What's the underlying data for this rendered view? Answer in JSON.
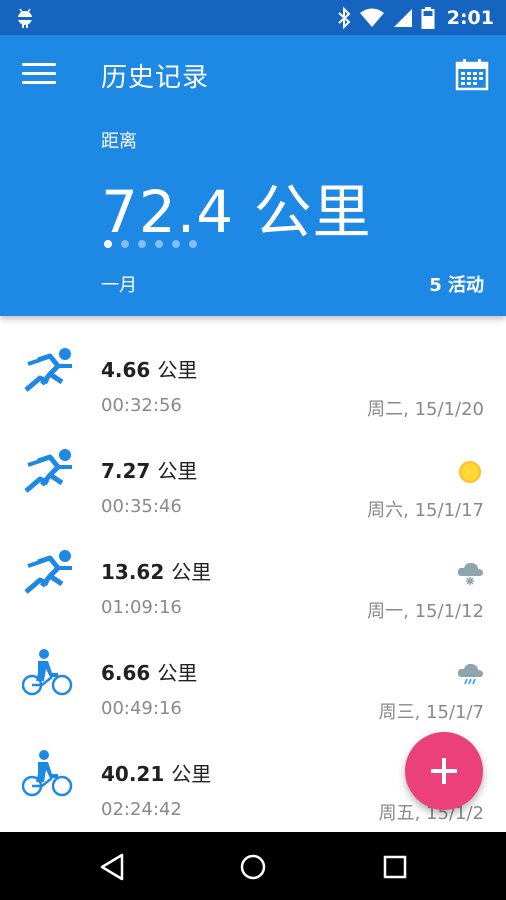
{
  "status_bar": {
    "time": "2:01",
    "icons": [
      "android-icon",
      "bluetooth-icon",
      "wifi-icon",
      "signal-icon",
      "battery-icon"
    ]
  },
  "header": {
    "title": "历史记录",
    "metric_label": "距离",
    "metric_value": "72.4 公里",
    "page_count": 6,
    "active_page": 0,
    "period": "一月",
    "activity_count": "5 活动",
    "colors": {
      "header_bg": "#1e88e5",
      "status_bg": "#1565c0"
    }
  },
  "activities": [
    {
      "type": "run-icon",
      "distance": "4.66",
      "unit": "公里",
      "duration": "00:32:56",
      "date": "周二, 15/1/20",
      "weather": ""
    },
    {
      "type": "run-icon",
      "distance": "7.27",
      "unit": "公里",
      "duration": "00:35:46",
      "date": "周六, 15/1/17",
      "weather": "sun-icon"
    },
    {
      "type": "run-icon",
      "distance": "13.62",
      "unit": "公里",
      "duration": "01:09:16",
      "date": "周一, 15/1/12",
      "weather": "snow-cloud-icon"
    },
    {
      "type": "bike-icon",
      "distance": "6.66",
      "unit": "公里",
      "duration": "00:49:16",
      "date": "周三, 15/1/7",
      "weather": "rain-cloud-icon"
    },
    {
      "type": "bike-icon",
      "distance": "40.21",
      "unit": "公里",
      "duration": "02:24:42",
      "date": "周五, 15/1/2",
      "weather": ""
    }
  ],
  "fab": {
    "icon": "plus-icon",
    "color": "#ec407a"
  },
  "navigation_bar": {
    "buttons": [
      "back-icon",
      "home-icon",
      "recents-icon"
    ]
  }
}
